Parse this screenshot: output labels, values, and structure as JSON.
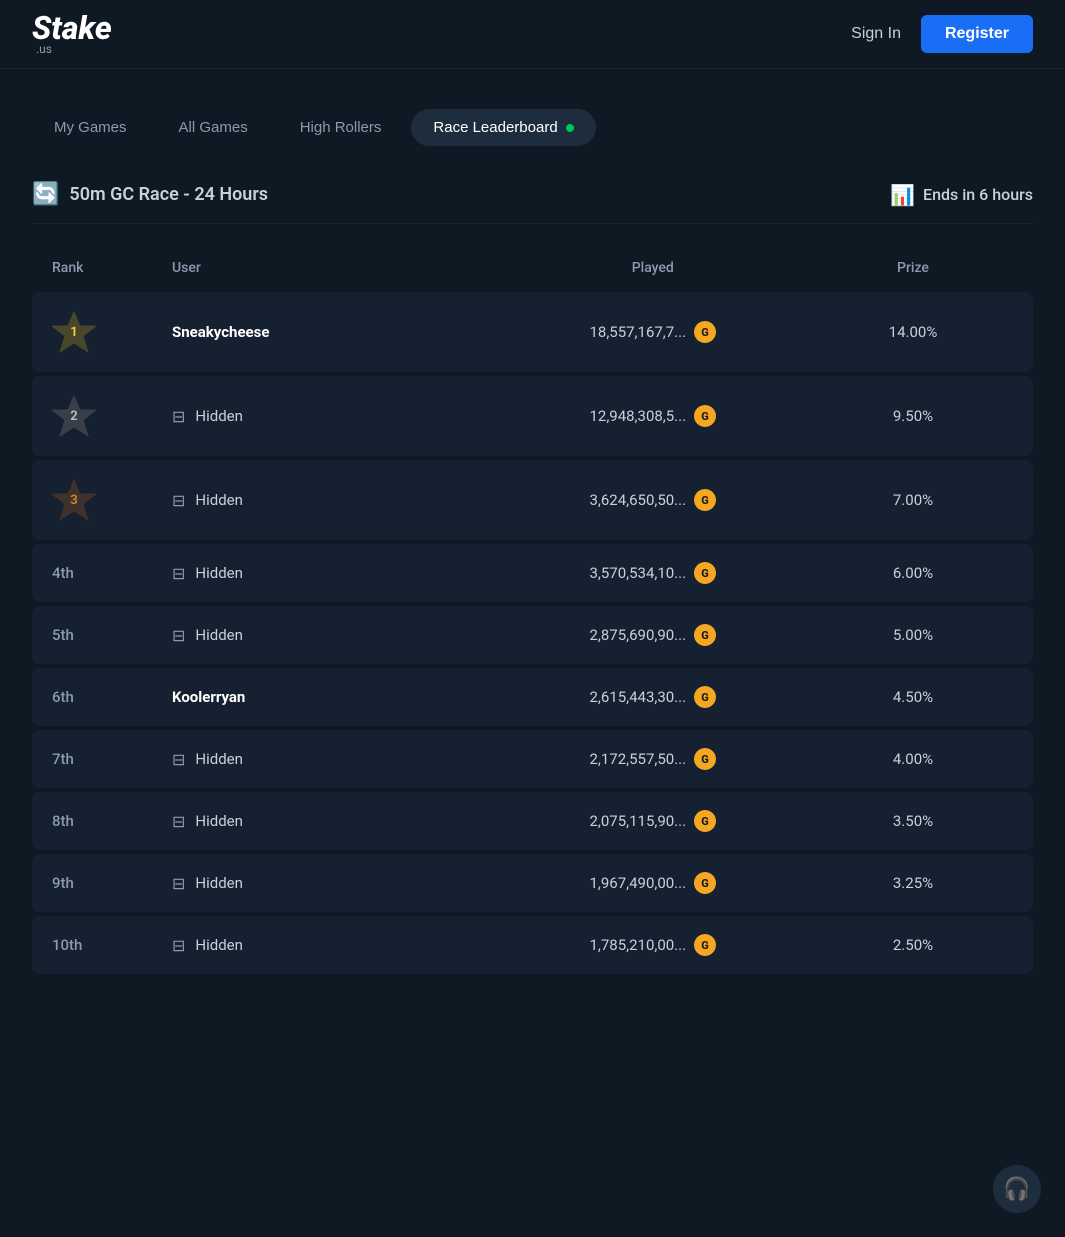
{
  "header": {
    "logo_main": "Stake",
    "logo_sub": ".us",
    "sign_in_label": "Sign In",
    "register_label": "Register"
  },
  "tabs": {
    "items": [
      {
        "id": "my-games",
        "label": "My Games",
        "active": false
      },
      {
        "id": "all-games",
        "label": "All Games",
        "active": false
      },
      {
        "id": "high-rollers",
        "label": "High Rollers",
        "active": false
      },
      {
        "id": "race-leaderboard",
        "label": "Race Leaderboard",
        "active": true
      }
    ]
  },
  "race": {
    "title": "50m GC Race - 24 Hours",
    "ends": "Ends in 6 hours"
  },
  "table": {
    "headers": {
      "rank": "Rank",
      "user": "User",
      "played": "Played",
      "prize": "Prize"
    },
    "rows": [
      {
        "rank": "1",
        "rank_type": "medal",
        "user": "Sneakycheese",
        "bold": true,
        "hidden": false,
        "played": "18,557,167,7...",
        "prize": "14.00%"
      },
      {
        "rank": "2",
        "rank_type": "medal",
        "user": "Hidden",
        "bold": false,
        "hidden": true,
        "played": "12,948,308,5...",
        "prize": "9.50%"
      },
      {
        "rank": "3",
        "rank_type": "medal",
        "user": "Hidden",
        "bold": false,
        "hidden": true,
        "played": "3,624,650,50...",
        "prize": "7.00%"
      },
      {
        "rank": "4th",
        "rank_type": "text",
        "user": "Hidden",
        "bold": false,
        "hidden": true,
        "played": "3,570,534,10...",
        "prize": "6.00%"
      },
      {
        "rank": "5th",
        "rank_type": "text",
        "user": "Hidden",
        "bold": false,
        "hidden": true,
        "played": "2,875,690,90...",
        "prize": "5.00%"
      },
      {
        "rank": "6th",
        "rank_type": "text",
        "user": "Koolerryan",
        "bold": true,
        "hidden": false,
        "played": "2,615,443,30...",
        "prize": "4.50%"
      },
      {
        "rank": "7th",
        "rank_type": "text",
        "user": "Hidden",
        "bold": false,
        "hidden": true,
        "played": "2,172,557,50...",
        "prize": "4.00%"
      },
      {
        "rank": "8th",
        "rank_type": "text",
        "user": "Hidden",
        "bold": false,
        "hidden": true,
        "played": "2,075,115,90...",
        "prize": "3.50%"
      },
      {
        "rank": "9th",
        "rank_type": "text",
        "user": "Hidden",
        "bold": false,
        "hidden": true,
        "played": "1,967,490,00...",
        "prize": "3.25%"
      },
      {
        "rank": "10th",
        "rank_type": "text",
        "user": "Hidden",
        "bold": false,
        "hidden": true,
        "played": "1,785,210,00...",
        "prize": "2.50%"
      }
    ]
  },
  "support": {
    "icon": "🎧"
  }
}
